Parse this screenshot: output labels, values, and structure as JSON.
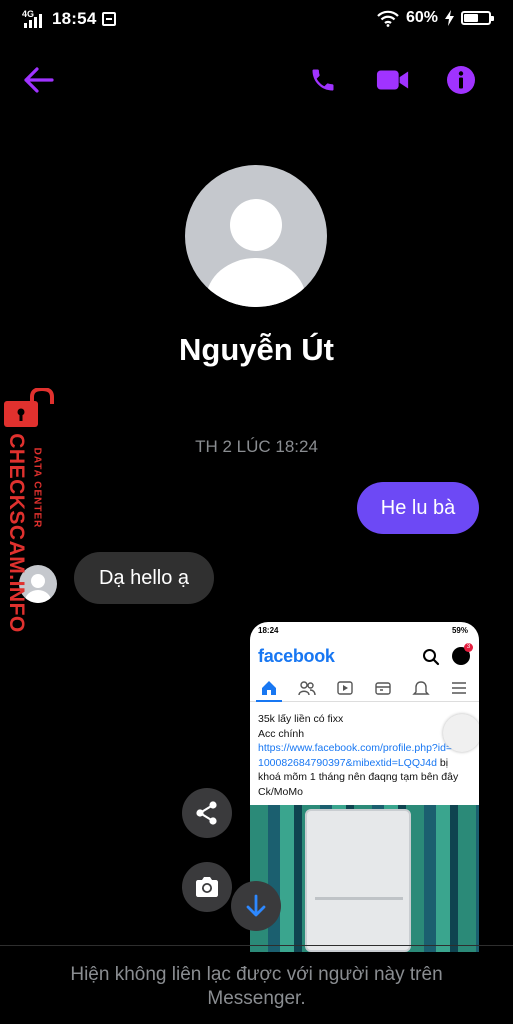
{
  "status_bar": {
    "network": "4G",
    "time": "18:54",
    "battery": "60%",
    "battery_level": 0.6
  },
  "header": {
    "back_icon": "arrow-left-icon",
    "call_icon": "phone-icon",
    "video_icon": "video-camera-icon",
    "info_icon": "info-icon",
    "accent": "#a033ff"
  },
  "profile": {
    "name": "Nguyễn Út"
  },
  "messages": {
    "timestamp": "TH 2 LÚC 18:24",
    "outgoing": "He lu bà",
    "incoming": "Dạ hello ạ",
    "outgoing_color": "#6d49f5",
    "incoming_color": "#303030"
  },
  "shared_image": {
    "status_time": "18:24",
    "status_battery": "59%",
    "notification_count": "3",
    "app_name": "facebook",
    "post_lines": [
      "35k lấy liền có fixx",
      "Acc chính"
    ],
    "post_link": "https://www.facebook.com/profile.php?id=",
    "post_link_2": "100082684790397&mibextid=LQQJ4d",
    "post_tail": " bị",
    "post_lines_2": [
      "khoá mõm 1 tháng nên đaqng tạm bên đây",
      "Ck/MoMo"
    ]
  },
  "floating": {
    "share_icon": "share-icon",
    "camera_icon": "camera-icon",
    "scroll_icon": "arrow-down-icon"
  },
  "footer": {
    "notice": "Hiện không liên lạc được với người này trên Messenger."
  },
  "watermark": {
    "main": "CHECKSCAM.INFO",
    "sub": "DATA CENTER",
    "color": "#e0312e"
  }
}
